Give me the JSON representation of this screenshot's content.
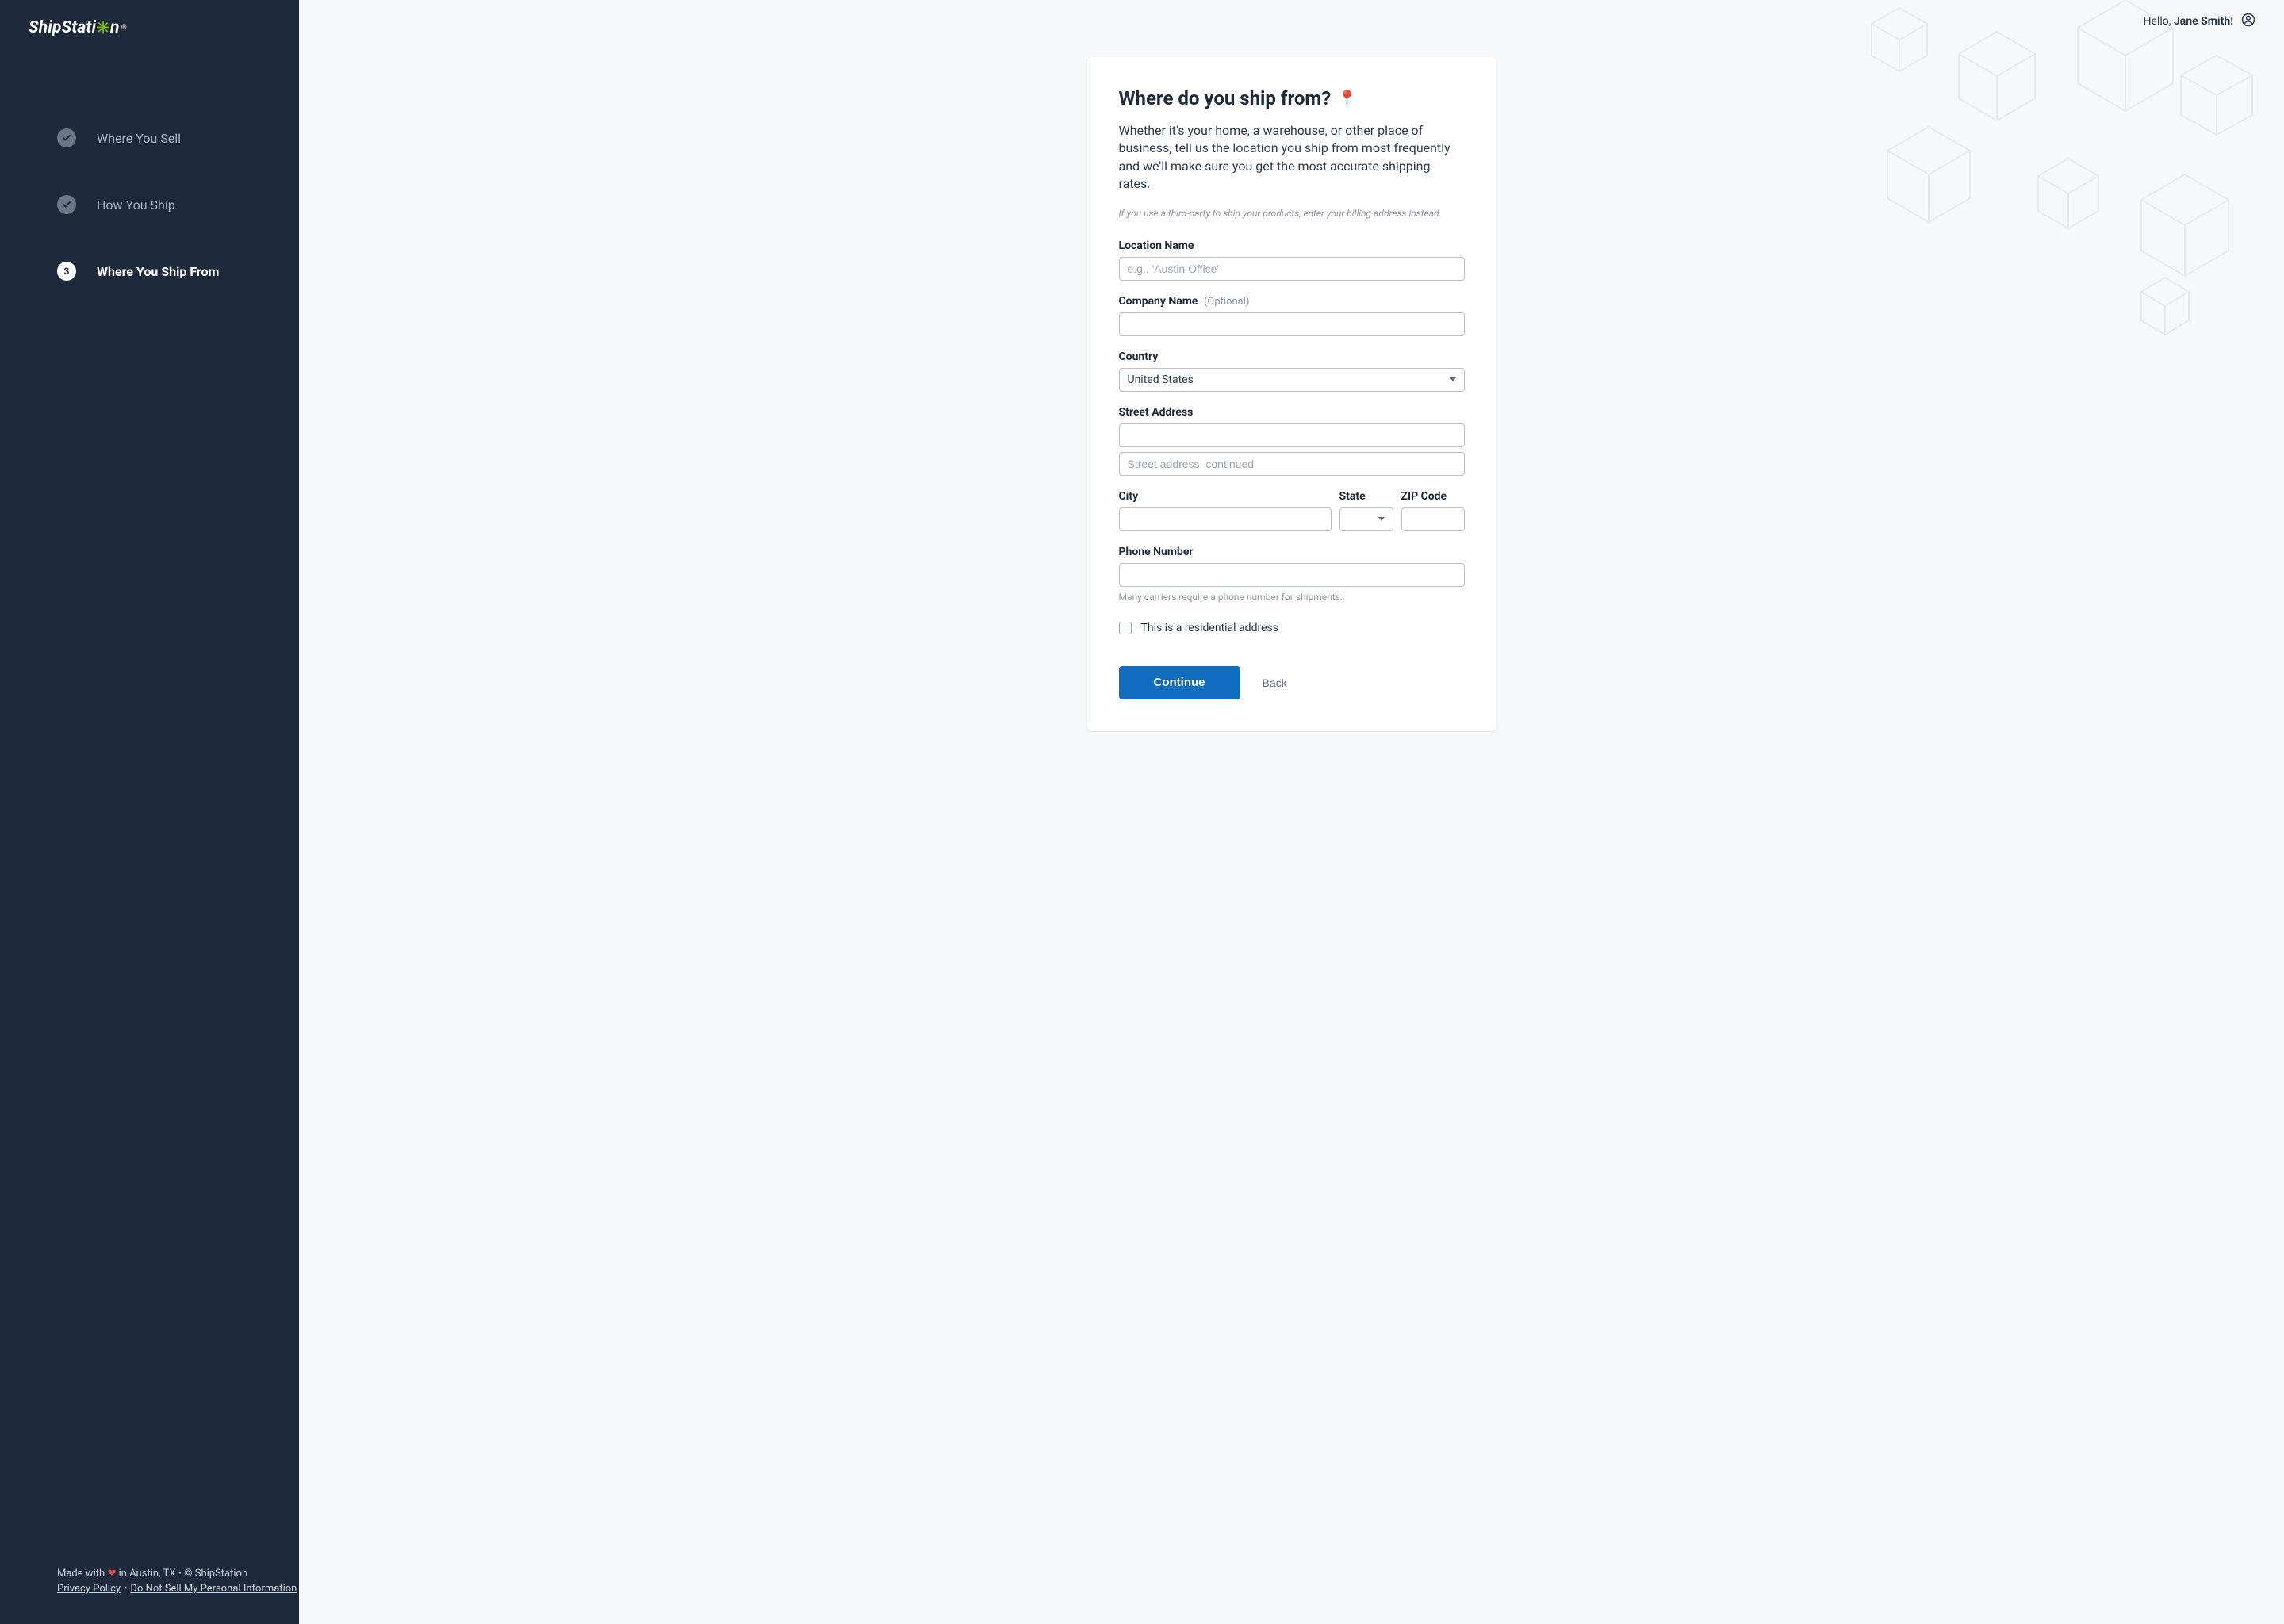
{
  "brand": {
    "name_left": "ShipStati",
    "name_right": "n",
    "gear_glyph": "✳",
    "reg": "®"
  },
  "sidebar": {
    "steps": [
      {
        "kind": "done",
        "label": "Where You Sell"
      },
      {
        "kind": "done",
        "label": "How You Ship"
      },
      {
        "kind": "current",
        "number": "3",
        "label": "Where You Ship From"
      }
    ],
    "footer": {
      "made_prefix": "Made with ",
      "made_suffix": " in Austin, TX • © ShipStation",
      "privacy": "Privacy Policy",
      "dnsmpi": "Do Not Sell My Personal Information"
    }
  },
  "topbar": {
    "hello_prefix": "Hello, ",
    "user_name": "Jane Smith!",
    "user_full": "Hello, Jane Smith!"
  },
  "card": {
    "title": "Where do you ship from?",
    "pin": "📍",
    "lead": "Whether it's your home, a warehouse, or other place of business, tell us the location you ship from most frequently and we'll make sure you get the most accurate shipping rates.",
    "note": "If you use a third-party to ship your products, enter your billing address instead."
  },
  "form": {
    "location_name": {
      "label": "Location Name",
      "placeholder": "e.g., 'Austin Office'",
      "value": ""
    },
    "company_name": {
      "label": "Company Name",
      "optional": "(Optional)",
      "value": ""
    },
    "country": {
      "label": "Country",
      "value": "United States"
    },
    "street": {
      "label": "Street Address",
      "value1": "",
      "value2": "",
      "placeholder2": "Street address, continued"
    },
    "city": {
      "label": "City",
      "value": ""
    },
    "state": {
      "label": "State",
      "value": ""
    },
    "zip": {
      "label": "ZIP Code",
      "value": ""
    },
    "phone": {
      "label": "Phone Number",
      "value": "",
      "help": "Many carriers require a phone number for shipments."
    },
    "residential": {
      "label": "This is a residential address",
      "checked": false
    }
  },
  "actions": {
    "continue": "Continue",
    "back": "Back"
  }
}
